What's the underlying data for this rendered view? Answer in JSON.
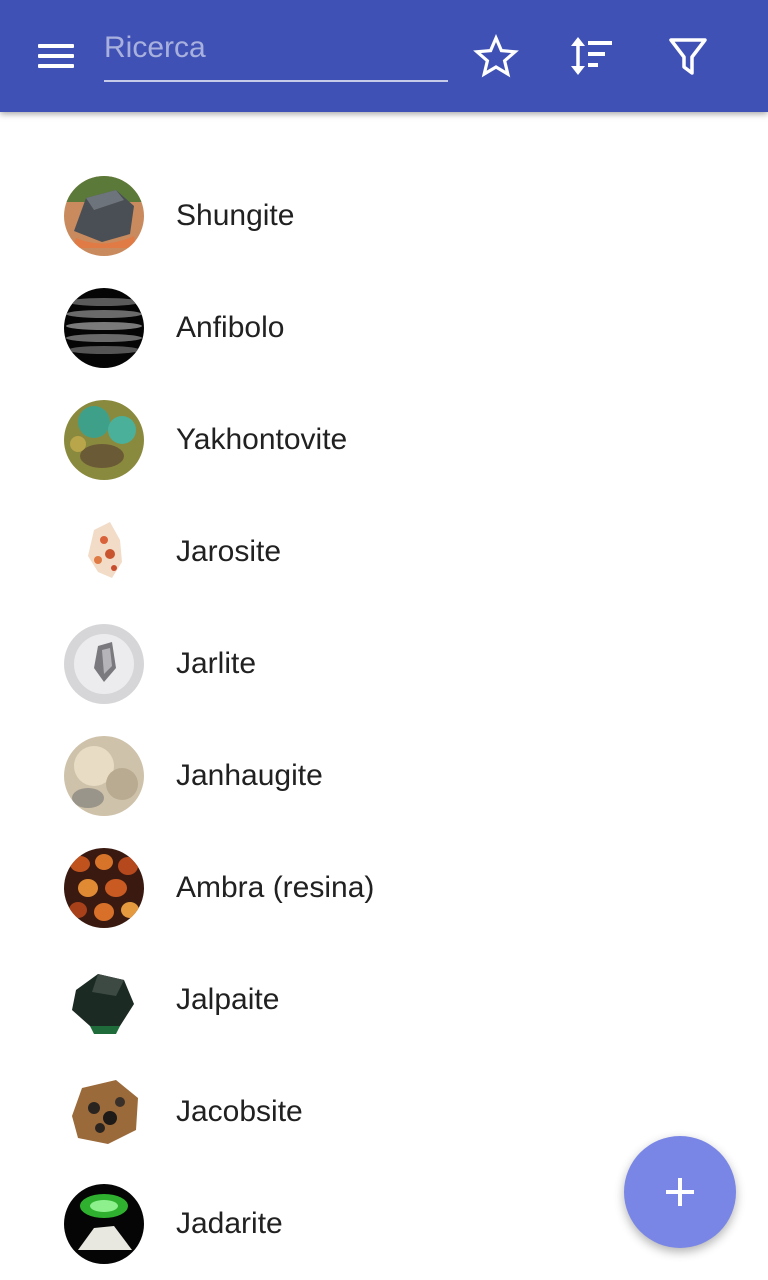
{
  "toolbar": {
    "search_placeholder": "Ricerca",
    "menu_icon": "menu-icon",
    "favorite_icon": "star-outline-icon",
    "sort_icon": "sort-icon",
    "filter_icon": "filter-icon"
  },
  "colors": {
    "appbar": "#3f51b5",
    "fab": "#7986e6",
    "text": "#212121"
  },
  "minerals": [
    {
      "name": "Shungite"
    },
    {
      "name": "Anfibolo"
    },
    {
      "name": "Yakhontovite"
    },
    {
      "name": "Jarosite"
    },
    {
      "name": "Jarlite"
    },
    {
      "name": "Janhaugite"
    },
    {
      "name": "Ambra (resina)"
    },
    {
      "name": "Jalpaite"
    },
    {
      "name": "Jacobsite"
    },
    {
      "name": "Jadarite"
    }
  ],
  "fab": {
    "icon": "plus-icon"
  }
}
